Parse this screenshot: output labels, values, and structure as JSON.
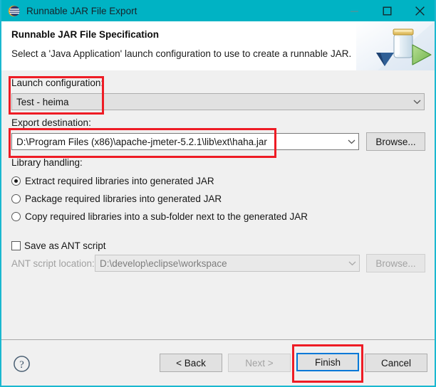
{
  "window": {
    "title": "Runnable JAR File Export",
    "icon": "eclipse-icon",
    "controls": {
      "minimize": "minimize-icon",
      "maximize": "maximize-icon",
      "close": "close-icon"
    }
  },
  "header": {
    "title": "Runnable JAR File Specification",
    "subtitle": "Select a 'Java Application' launch configuration to use to create a runnable JAR.",
    "banner_icon": "jar-export-icon"
  },
  "launch_configuration": {
    "label": "Launch configuration:",
    "value": "Test - heima",
    "enabled": false
  },
  "export_destination": {
    "label": "Export destination:",
    "value": "D:\\Program Files (x86)\\apache-jmeter-5.2.1\\lib\\ext\\haha.jar",
    "browse_label": "Browse..."
  },
  "library_handling": {
    "label": "Library handling:",
    "options": [
      {
        "label": "Extract required libraries into generated JAR",
        "selected": true
      },
      {
        "label": "Package required libraries into generated JAR",
        "selected": false
      },
      {
        "label": "Copy required libraries into a sub-folder next to the generated JAR",
        "selected": false
      }
    ]
  },
  "ant_script": {
    "checkbox_label": "Save as ANT script",
    "checked": false,
    "location_label": "ANT script location:",
    "location_value": "D:\\develop\\eclipse\\workspace",
    "browse_label": "Browse...",
    "enabled": false
  },
  "footer": {
    "help_icon": "help-icon",
    "buttons": [
      {
        "label": "< Back",
        "enabled": true,
        "focused": false
      },
      {
        "label": "Next >",
        "enabled": false,
        "focused": false
      },
      {
        "label": "Finish",
        "enabled": true,
        "focused": true
      },
      {
        "label": "Cancel",
        "enabled": true,
        "focused": false
      }
    ]
  },
  "annotations": [
    {
      "name": "launch-configuration-highlight"
    },
    {
      "name": "export-destination-highlight"
    },
    {
      "name": "finish-button-highlight"
    }
  ],
  "colors": {
    "titlebar": "#00b3c4",
    "annotation": "#ee1c25",
    "focus": "#0078d7",
    "body": "#f0f0f0"
  }
}
